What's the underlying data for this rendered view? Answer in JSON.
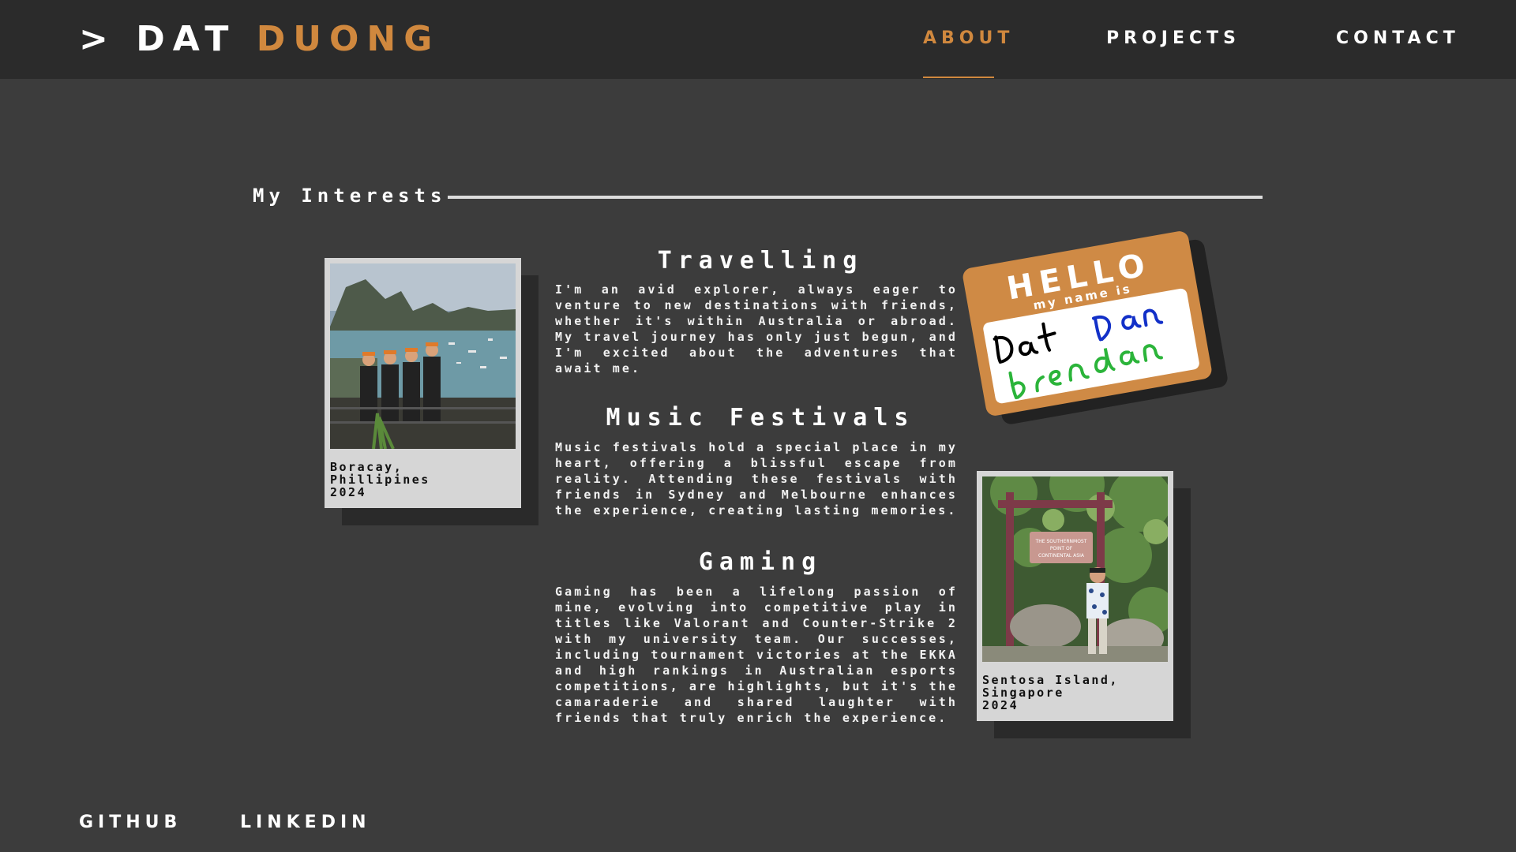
{
  "header": {
    "prompt": ">",
    "first_name": "DAT",
    "last_name": "DUONG",
    "nav": [
      "ABOUT",
      "PROJECTS",
      "CONTACT"
    ],
    "active": "ABOUT"
  },
  "section": {
    "title": "My Interests"
  },
  "interests": [
    {
      "title": "Travelling",
      "text": "I'm an avid explorer, always eager to venture to new destinations with friends, whether it's within Australia or abroad. My travel journey has only just begun, and I'm excited about the adventures that await me."
    },
    {
      "title": "Music Festivals",
      "text": "Music festivals hold a special place in my heart, offering a blissful escape from reality. Attending these festivals with friends in Sydney and Melbourne enhances the experience, creating lasting memories."
    },
    {
      "title": "Gaming",
      "text": "Gaming has been a lifelong passion of mine, evolving into competitive play in titles like Valorant and Counter-Strike 2 with my university team. Our successes, including tournament victories at the EKKA and high rankings in Australian esports competitions, are highlights, but it's the camaraderie and shared laughter with friends that truly enrich the experience."
    }
  ],
  "photos": [
    {
      "caption": "Boracay,\nPhillipines\n2024"
    },
    {
      "caption": "Sentosa Island,\nSingapore\n2024",
      "sign_text": "THE SOUTHERNMOST POINT OF CONTINENTAL ASIA"
    }
  ],
  "badge": {
    "hello": "HELLO",
    "subtitle": "my name is",
    "names": [
      "Dat",
      "Dan",
      "Brendan"
    ]
  },
  "footer": {
    "links": [
      "GITHUB",
      "LINKEDIN"
    ]
  },
  "colors": {
    "accent": "#d0883e",
    "background": "#3c3c3c",
    "nav_bg": "#2b2b2b"
  }
}
